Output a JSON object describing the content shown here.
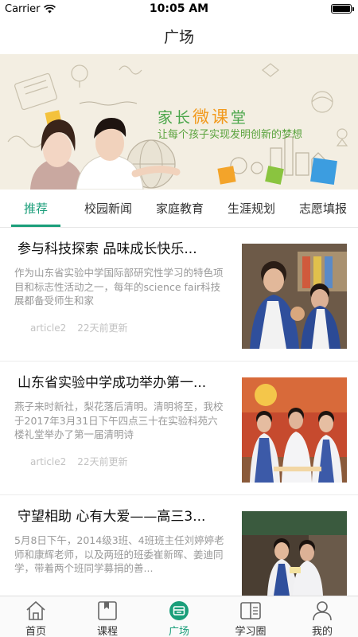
{
  "status_bar": {
    "carrier": "Carrier",
    "time": "10:05 AM",
    "battery_level": 1.0
  },
  "nav": {
    "title": "广场"
  },
  "banner": {
    "title_part1": "家长",
    "title_highlight": "微课",
    "title_part2": "堂",
    "subtitle": "让每个孩子实现发明创新的梦想"
  },
  "tabs": [
    {
      "label": "推荐",
      "active": true
    },
    {
      "label": "校园新闻",
      "active": false
    },
    {
      "label": "家庭教育",
      "active": false
    },
    {
      "label": "生涯规划",
      "active": false
    },
    {
      "label": "志愿填报",
      "active": false
    }
  ],
  "articles": [
    {
      "title": "参与科技探索 品味成长快乐...",
      "summary": "作为山东省实验中学国际部研究性学习的特色项目和标志性活动之一，每年的science fair科技展都备受师生和家",
      "source": "article2",
      "updated": "22天前更新"
    },
    {
      "title": "山东省实验中学成功举办第一...",
      "summary": "燕子来时新社，梨花落后清明。清明将至，我校于2017年3月31日下午四点三十在实验科苑六楼礼堂举办了第一届清明诗",
      "source": "article2",
      "updated": "22天前更新"
    },
    {
      "title": "守望相助 心有大爱——高三3...",
      "summary": "5月8日下午，2014级3班、4班班主任刘婷婷老师和康辉老师，以及两班的班委崔新晖、姜迪同学，带着两个班同学募捐的善...",
      "source": "",
      "updated": ""
    }
  ],
  "tabbar": [
    {
      "label": "首页",
      "icon": "home-icon",
      "active": false
    },
    {
      "label": "课程",
      "icon": "bookmark-book-icon",
      "active": false
    },
    {
      "label": "广场",
      "icon": "square-plaza-icon",
      "active": true
    },
    {
      "label": "学习圈",
      "icon": "open-book-icon",
      "active": false
    },
    {
      "label": "我的",
      "icon": "person-icon",
      "active": false
    }
  ],
  "colors": {
    "accent": "#1a9e7a",
    "banner_bg": "#f3eee2",
    "banner_green": "#4aa64a",
    "banner_orange": "#f29a1d"
  }
}
